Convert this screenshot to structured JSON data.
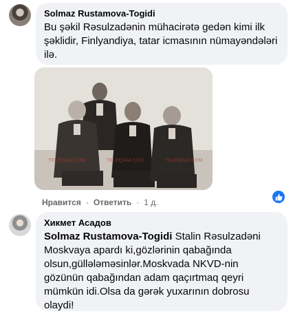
{
  "comment1": {
    "author": "Solmaz Rustamova-Togidi",
    "text": "Bu şəkil Rəsulzadənin mühacirətə gedən kimi ilk şəklidir, Finlyandiya, tatar icmasının nümayəndələri ilə.",
    "photo": {
      "watermarks": [
        "TELEQRAF.COM",
        "TELEQRAF.COM",
        "TELEQRAF.COM"
      ]
    },
    "actions": {
      "like": "Нравится",
      "reply": "Ответить",
      "time": "1 д."
    },
    "reaction_icon": "like-icon",
    "reaction_color": "#1877f2"
  },
  "comment2": {
    "author": "Хикмет Асадов",
    "mention": "Solmaz Rustamova-Togidi",
    "text": " Stalin Rəsulzadəni Moskvaya apardı ki,gözlərinin qabağında olsun,güllələməsinlər.Moskvada NKVD-nin gözünün qabağından adam qaçırtmaq qeyri mümkün idi.Olsa da gərək yuxarının dobrosu olaydi!"
  },
  "colors": {
    "bubble": "#f0f2f5",
    "text": "#050505",
    "meta": "#65676b"
  }
}
